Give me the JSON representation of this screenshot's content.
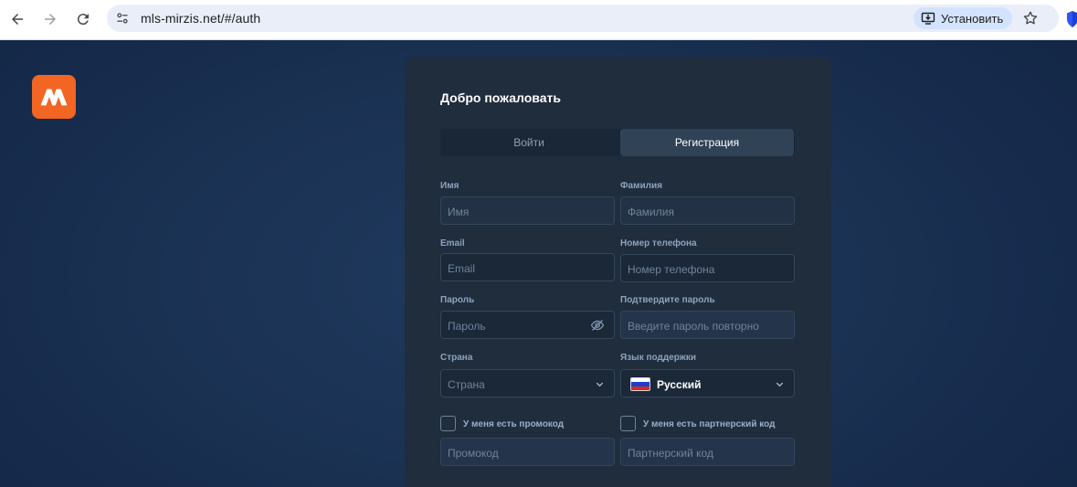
{
  "browser": {
    "url": "mls-mirzis.net/#/auth",
    "install_label": "Установить"
  },
  "card": {
    "title": "Добро пожаловать",
    "tabs": [
      {
        "label": "Войти",
        "active": false
      },
      {
        "label": "Регистрация",
        "active": true
      }
    ],
    "fields": {
      "first_name": {
        "label": "Имя",
        "placeholder": "Имя"
      },
      "last_name": {
        "label": "Фамилия",
        "placeholder": "Фамилия"
      },
      "email": {
        "label": "Email",
        "placeholder": "Email"
      },
      "phone": {
        "label": "Номер телефона",
        "placeholder": "Номер телефона"
      },
      "password": {
        "label": "Пароль",
        "placeholder": "Пароль"
      },
      "confirm_password": {
        "label": "Подтвердите пароль",
        "placeholder": "Введите пароль повторно"
      },
      "country": {
        "label": "Страна",
        "placeholder": "Страна"
      },
      "support_language": {
        "label": "Язык поддержки",
        "value": "Русский"
      }
    },
    "checkboxes": {
      "promo": {
        "label": "У меня есть промокод",
        "placeholder": "Промокод",
        "checked": false
      },
      "partner": {
        "label": "У меня есть партнерский код",
        "placeholder": "Партнерский код",
        "checked": false
      }
    }
  },
  "colors": {
    "accent": "#f26522",
    "card_bg": "#1f2d3d",
    "page_bg": "#1a3152"
  }
}
